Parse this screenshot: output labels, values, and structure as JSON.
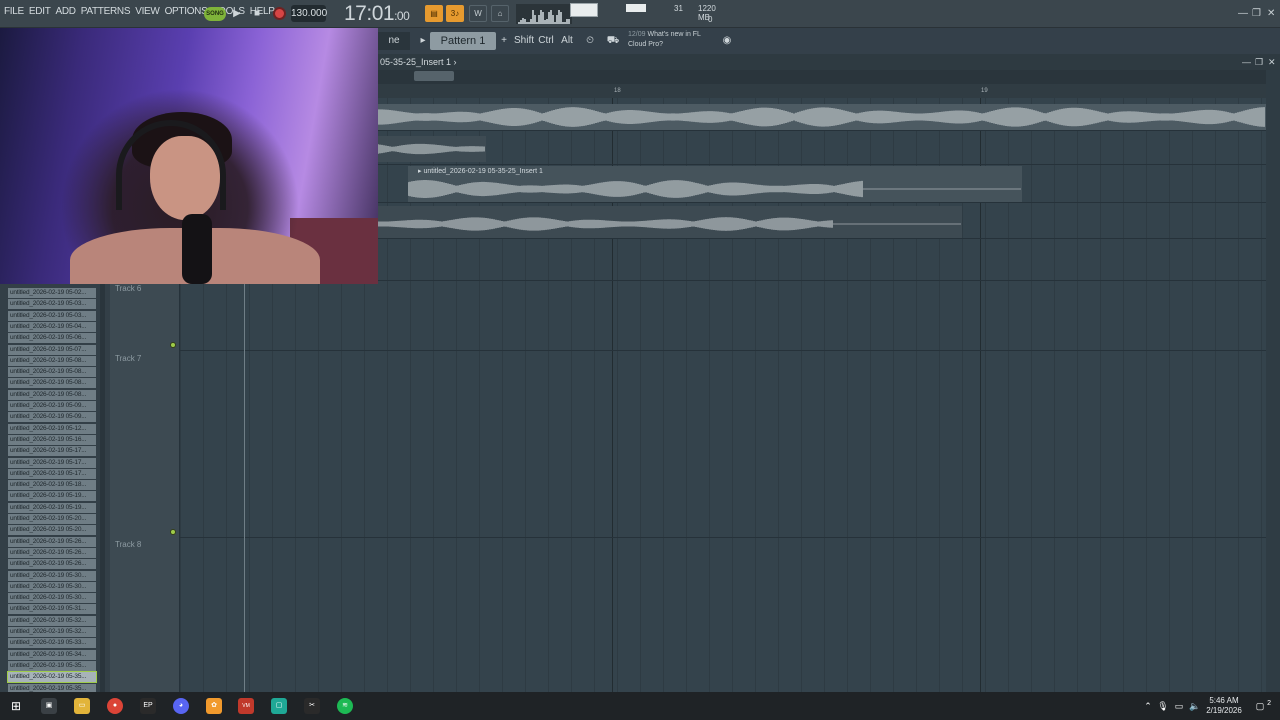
{
  "menu": [
    "FILE",
    "EDIT",
    "ADD",
    "PATTERNS",
    "VIEW",
    "OPTIONS",
    "TOOLS",
    "HELP"
  ],
  "transport": {
    "song_label": "SONG",
    "tempo": "130.000",
    "time": "17:01",
    "time_small": ":00",
    "cpu": "31",
    "memory": "1220 MB",
    "polyphony": "0"
  },
  "toolbar2": {
    "snap": "ne",
    "pattern": "Pattern 1",
    "shift": "Shift",
    "ctrl": "Ctrl",
    "alt": "Alt",
    "news_date": "12/09",
    "news_line1": "What's new in FL",
    "news_line2": "Cloud Pro?"
  },
  "playlist": {
    "title": "05-35-25_Insert 1",
    "ruler": [
      "18",
      "19"
    ],
    "clip_label": "untitled_2026-02-19 05-35-25_Insert 1",
    "tracks": [
      "Track 6",
      "Track 7",
      "Track 8"
    ]
  },
  "browser_items": [
    "untitled_2026-02-19 05-02...",
    "untitled_2026-02-19 05-03...",
    "untitled_2026-02-19 05-03...",
    "untitled_2026-02-19 05-04...",
    "untitled_2026-02-19 05-06...",
    "untitled_2026-02-19 05-07...",
    "untitled_2026-02-19 05-08...",
    "untitled_2026-02-19 05-08...",
    "untitled_2026-02-19 05-08...",
    "untitled_2026-02-19 05-08...",
    "untitled_2026-02-19 05-09...",
    "untitled_2026-02-19 05-09...",
    "untitled_2026-02-19 05-12...",
    "untitled_2026-02-19 05-16...",
    "untitled_2026-02-19 05-17...",
    "untitled_2026-02-19 05-17...",
    "untitled_2026-02-19 05-17...",
    "untitled_2026-02-19 05-18...",
    "untitled_2026-02-19 05-19...",
    "untitled_2026-02-19 05-19...",
    "untitled_2026-02-19 05-20...",
    "untitled_2026-02-19 05-20...",
    "untitled_2026-02-19 05-26...",
    "untitled_2026-02-19 05-26...",
    "untitled_2026-02-19 05-26...",
    "untitled_2026-02-19 05-30...",
    "untitled_2026-02-19 05-30...",
    "untitled_2026-02-19 05-30...",
    "untitled_2026-02-19 05-31...",
    "untitled_2026-02-19 05-32...",
    "untitled_2026-02-19 05-32...",
    "untitled_2026-02-19 05-33...",
    "untitled_2026-02-19 05-34...",
    "untitled_2026-02-19 05-35...",
    "untitled_2026-02-19 05-35...",
    "untitled_2026-02-19 05-35..."
  ],
  "selected_browser_index": 34,
  "taskbar": {
    "time": "5:46 AM",
    "date": "2/19/2026",
    "notifications": "2"
  },
  "colors": {
    "accent_green": "#9fcc4a",
    "accent_orange": "#e69a2f",
    "record_red": "#d64545"
  }
}
